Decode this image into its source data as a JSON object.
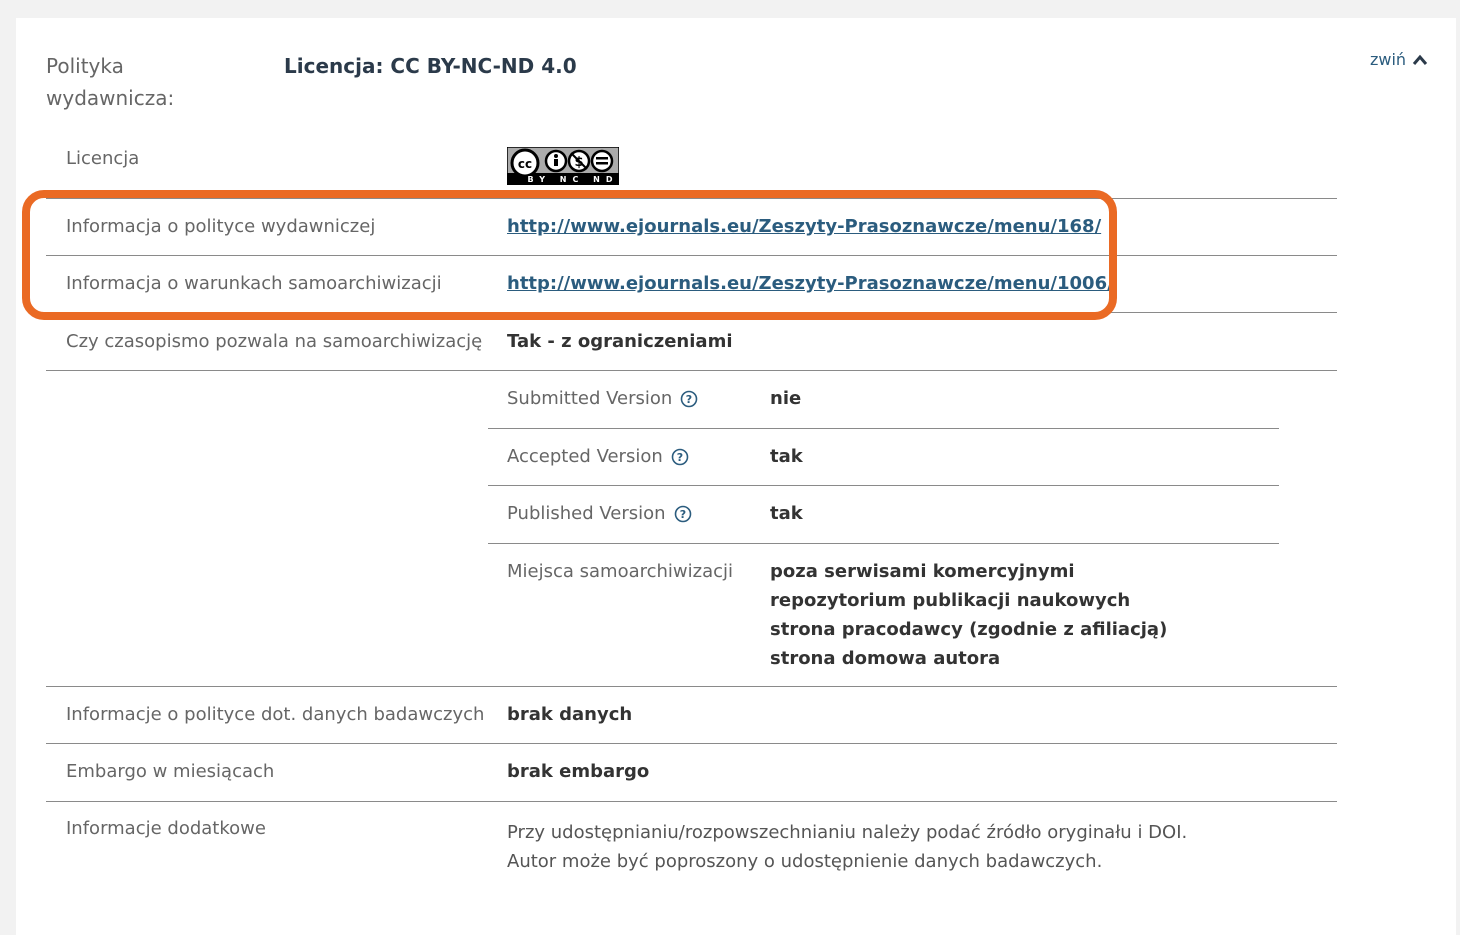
{
  "header": {
    "section_label": "Polityka\nwydawnicza:",
    "license_title": "Licencja: CC BY-NC-ND 4.0",
    "collapse_label": "zwiń"
  },
  "rows": {
    "license_label": "Licencja",
    "cc_badge_text": "BY NC ND",
    "publisher_policy_label": "Informacja o polityce wydawniczej",
    "publisher_policy_link": "http://www.ejournals.eu/Zeszyty-Prasoznawcze/menu/168/",
    "selfarchive_conditions_label": "Informacja o warunkach samoarchiwizacji",
    "selfarchive_conditions_link": "http://www.ejournals.eu/Zeszyty-Prasoznawcze/menu/1006/",
    "allows_selfarchive_label": "Czy czasopismo pozwala na samoarchiwizację",
    "allows_selfarchive_value": "Tak - z ograniczeniami",
    "research_data_label": "Informacje o polityce dot. danych badawczych",
    "research_data_value": "brak danych",
    "embargo_label": "Embargo w miesiącach",
    "embargo_value": "brak embargo",
    "additional_info_label": "Informacje dodatkowe",
    "additional_info_line1": "Przy udostępnianiu/rozpowszechnianiu należy podać źródło oryginału i DOI.",
    "additional_info_line2": "Autor może być poproszony o udostępnienie danych badawczych."
  },
  "versions": {
    "submitted_label": "Submitted Version",
    "submitted_value": "nie",
    "accepted_label": "Accepted Version",
    "accepted_value": "tak",
    "published_label": "Published Version",
    "published_value": "tak",
    "places_label": "Miejsca samoarchiwizacji",
    "places": [
      "poza serwisami komercyjnymi",
      "repozytorium publikacji naukowych",
      "strona pracodawcy (zgodnie z afiliacją)",
      "strona domowa autora"
    ]
  },
  "colors": {
    "highlight": "#ea6a24",
    "link": "#2b5c7e"
  }
}
